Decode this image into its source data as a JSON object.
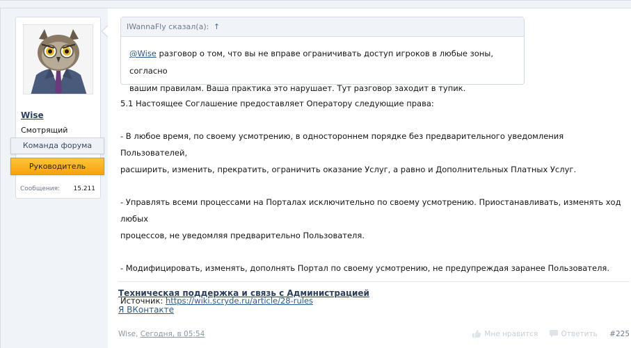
{
  "user": {
    "name": "Wise",
    "title": "Смотрящий",
    "banner_team": "Команда форума",
    "banner_lead": "Руководитель",
    "stat_label": "Сообщения:",
    "stat_value": "15.211"
  },
  "quote": {
    "author_line": "IWannaFly сказал(а):",
    "arrow": "↑",
    "mention": "@Wise",
    "line1_rest": " разговор о том, что вы не вправе ограничивать доступ игроков в любые зоны, согласно",
    "line2": "вашим правилам. Ваша практика это нарушает. Тут разговор заходит в тупик."
  },
  "post": {
    "p1": "5.1 Настоящее Соглашение предоставляет Оператору следующие права:",
    "p2a": "- В любое время, по своему усмотрению, в одностороннем порядке без предварительного уведомления Пользователей,",
    "p2b": "расширить, изменить, прекратить, ограничить оказание Услуг, а равно и Дополнительных Платных Услуг.",
    "p3a": "- Управлять всеми процессами на Порталах исключительно по своему усмотрению. Приостанавливать, изменять ход любых",
    "p3b": "процессов, не уведомляя предварительно Пользователя.",
    "p4": "- Модифицировать, изменять, дополнять Портал по своему усмотрению, не предупреждая заранее Пользователя.",
    "source_label": "Источник: ",
    "source_link": "https://wiki.scryde.ru/article/28-rules"
  },
  "signature": {
    "link1": "Техническая поддержка и связь с Администрацией",
    "link2": "Я ВКонтакте"
  },
  "footer": {
    "author": "Wise",
    "separator": ", ",
    "date": "Сегодня, в 05:54",
    "like": "Мне нравится",
    "reply": "Ответить",
    "number": "#225"
  }
}
